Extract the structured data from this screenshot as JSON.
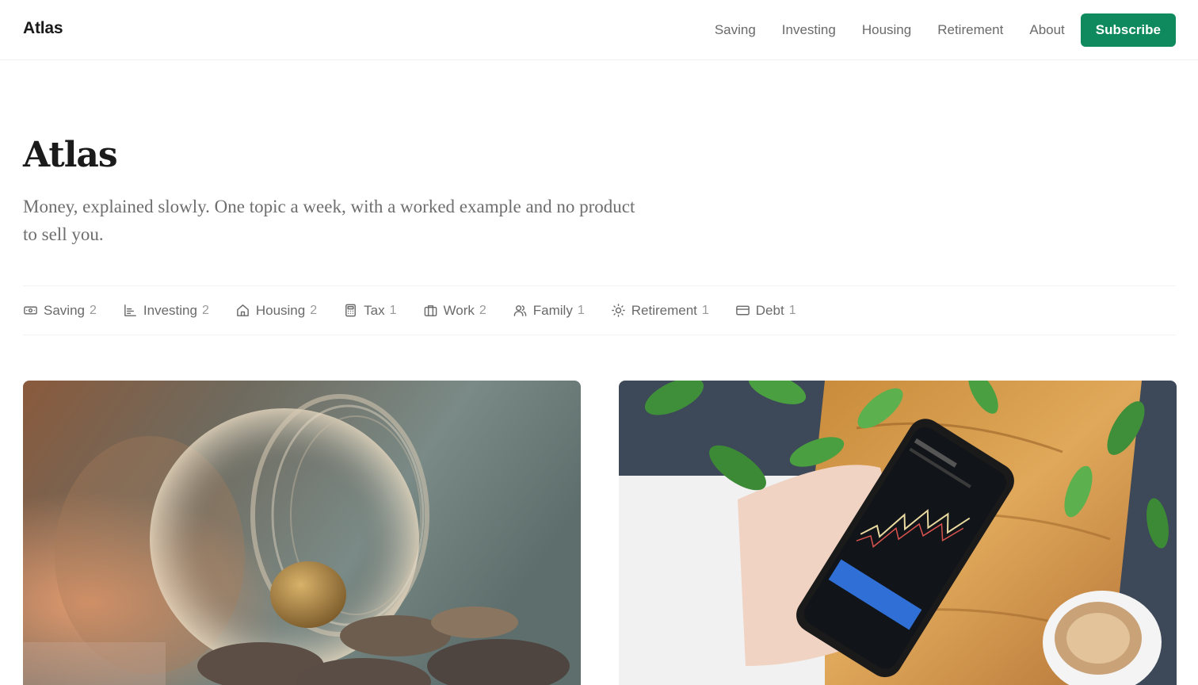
{
  "header": {
    "brand": "Atlas",
    "nav": [
      {
        "label": "Saving"
      },
      {
        "label": "Investing"
      },
      {
        "label": "Housing"
      },
      {
        "label": "Retirement"
      },
      {
        "label": "About"
      }
    ],
    "subscribe_label": "Subscribe"
  },
  "hero": {
    "title": "Atlas",
    "subtitle": "Money, explained slowly. One topic a week, with a worked example and no product to sell you."
  },
  "categories": [
    {
      "label": "Saving",
      "count": "2",
      "icon": "banknote-icon"
    },
    {
      "label": "Investing",
      "count": "2",
      "icon": "chart-icon"
    },
    {
      "label": "Housing",
      "count": "2",
      "icon": "house-icon"
    },
    {
      "label": "Tax",
      "count": "1",
      "icon": "calculator-icon"
    },
    {
      "label": "Work",
      "count": "2",
      "icon": "briefcase-icon"
    },
    {
      "label": "Family",
      "count": "1",
      "icon": "people-icon"
    },
    {
      "label": "Retirement",
      "count": "1",
      "icon": "sun-icon"
    },
    {
      "label": "Debt",
      "count": "1",
      "icon": "credit-card-icon"
    }
  ],
  "colors": {
    "accent": "#0f8a5f",
    "text": "#1b1b1b",
    "muted": "#6a6a6a"
  }
}
